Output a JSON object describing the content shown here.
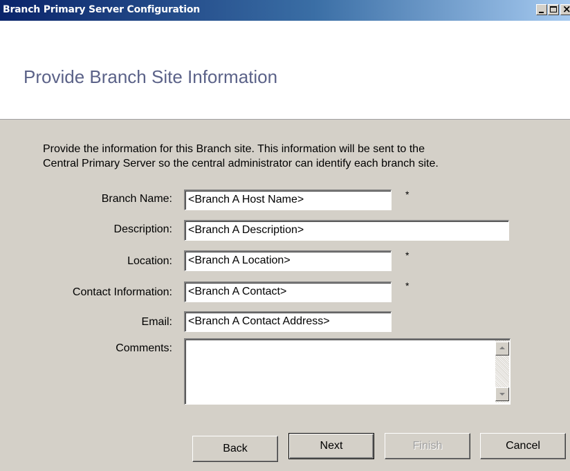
{
  "window": {
    "title": "Branch Primary Server Configuration"
  },
  "header": {
    "heading": "Provide Branch Site Information"
  },
  "intro": {
    "line1": "Provide the information for this Branch site. This information will be sent to the",
    "line2": "Central Primary Server so the central administrator can identify each branch site."
  },
  "form": {
    "branch_name": {
      "label": "Branch Name:",
      "value": "<Branch A Host Name>",
      "required_mark": "*"
    },
    "description": {
      "label": "Description:",
      "value": "<Branch A Description>"
    },
    "location": {
      "label": "Location:",
      "value": "<Branch A Location>",
      "required_mark": "*"
    },
    "contact": {
      "label": "Contact Information:",
      "value": "<Branch A Contact>",
      "required_mark": "*"
    },
    "email": {
      "label": "Email:",
      "value": "<Branch A Contact Address>"
    },
    "comments": {
      "label": "Comments:",
      "value": ""
    }
  },
  "buttons": {
    "back": "Back",
    "next": "Next",
    "finish": "Finish",
    "cancel": "Cancel"
  },
  "icons": {
    "minimize": "minimize-icon",
    "maximize": "maximize-icon",
    "close": "close-icon"
  },
  "colors": {
    "titlebar_start": "#0a246a",
    "titlebar_end": "#a6caf0",
    "heading_text": "#5b6288",
    "dialog_bg": "#d4d0c8"
  }
}
